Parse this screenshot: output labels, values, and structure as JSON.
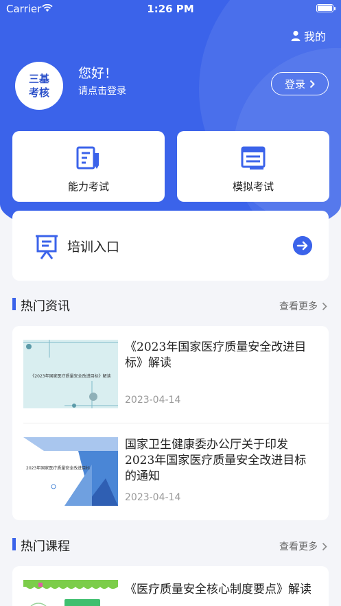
{
  "status_bar": {
    "carrier": "Carrier",
    "time": "1:26 PM"
  },
  "header": {
    "me_label": "我的",
    "avatar_line1": "三基",
    "avatar_line2": "考核",
    "greeting": "您好！",
    "greeting_sub": "请点击登录",
    "login_label": "登录"
  },
  "actions": [
    {
      "label": "能力考试",
      "icon": "ability-exam-icon"
    },
    {
      "label": "模拟考试",
      "icon": "mock-exam-icon"
    }
  ],
  "training": {
    "label": "培训入口",
    "icon": "training-board-icon"
  },
  "hot_news": {
    "title": "热门资讯",
    "more": "查看更多",
    "items": [
      {
        "title": "《2023年国家医疗质量安全改进目标》解读",
        "date": "2023-04-14",
        "thumb_text": "《2023年国家医疗质量安全改进目标》解读"
      },
      {
        "title": "国家卫生健康委办公厅关于印发2023年国家医疗质量安全改进目标的通知",
        "date": "2023-04-14",
        "thumb_text": "2023年国家医疗质量安全改进目标"
      }
    ]
  },
  "hot_courses": {
    "title": "热门课程",
    "more": "查看更多",
    "items": [
      {
        "title": "《医疗质量安全核心制度要点》解读"
      }
    ]
  },
  "colors": {
    "primary": "#3b63ea",
    "background": "#f4f5f9"
  }
}
